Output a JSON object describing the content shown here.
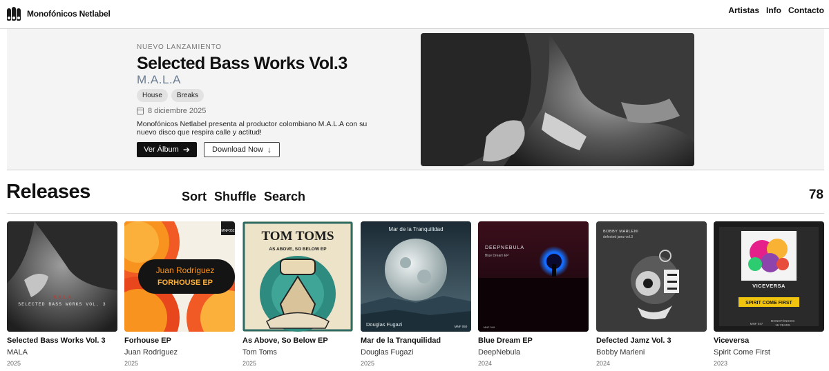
{
  "header": {
    "brand": "Monofónicos Netlabel",
    "nav": [
      "Artistas",
      "Info",
      "Contacto"
    ]
  },
  "hero": {
    "kicker": "NUEVO LANZAMIENTO",
    "title": "Selected Bass Works Vol.3",
    "artist": "M.A.L.A",
    "tags": [
      "House",
      "Breaks"
    ],
    "date": "8 diciembre 2025",
    "description": "Monofónicos Netlabel presenta al productor colombiano M.A.L.A con su nuevo disco que respira calle y actitud!",
    "primary_button": "Ver Álbum",
    "secondary_button": "Download Now"
  },
  "releases": {
    "title": "Releases",
    "actions": [
      "Sort",
      "Shuffle",
      "Search"
    ],
    "count": "78",
    "items": [
      {
        "title": "Selected Bass Works Vol. 3",
        "artist": "MALA",
        "year": "2025",
        "cover_text": [
          "M.A.L.A",
          "SELECTED BASS WORKS VOL. 3"
        ]
      },
      {
        "title": "Forhouse EP",
        "artist": "Juan Rodriguez",
        "year": "2025",
        "cover_text": [
          "Juan Rodríguez",
          "FORHOUSE EP",
          "MNF052"
        ]
      },
      {
        "title": "As Above, So Below EP",
        "artist": "Tom Toms",
        "year": "2025",
        "cover_text": [
          "TOM TOMS",
          "AS ABOVE, SO BELOW EP"
        ]
      },
      {
        "title": "Mar de la Tranquilidad",
        "artist": "Douglas Fugazi",
        "year": "2025",
        "cover_text": [
          "Mar de la Tranquilidad",
          "Douglas Fugazi",
          "MNF 050"
        ]
      },
      {
        "title": "Blue Dream EP",
        "artist": "DeepNebula",
        "year": "2024",
        "cover_text": [
          "DEEPNEBULA",
          "Blue Dream EP",
          "MNF 049"
        ]
      },
      {
        "title": "Defected Jamz Vol. 3",
        "artist": "Bobby Marleni",
        "year": "2024",
        "cover_text": [
          "BOBBY MARLENI",
          "defected jamz vol.3"
        ]
      },
      {
        "title": "Viceversa",
        "artist": "Spirit Come First",
        "year": "2023",
        "cover_text": [
          "VICEVERSA",
          "SPIRIT COME FIRST",
          "MNF 047",
          "MONOFÓNICOS",
          "15 YEARS"
        ]
      }
    ]
  }
}
